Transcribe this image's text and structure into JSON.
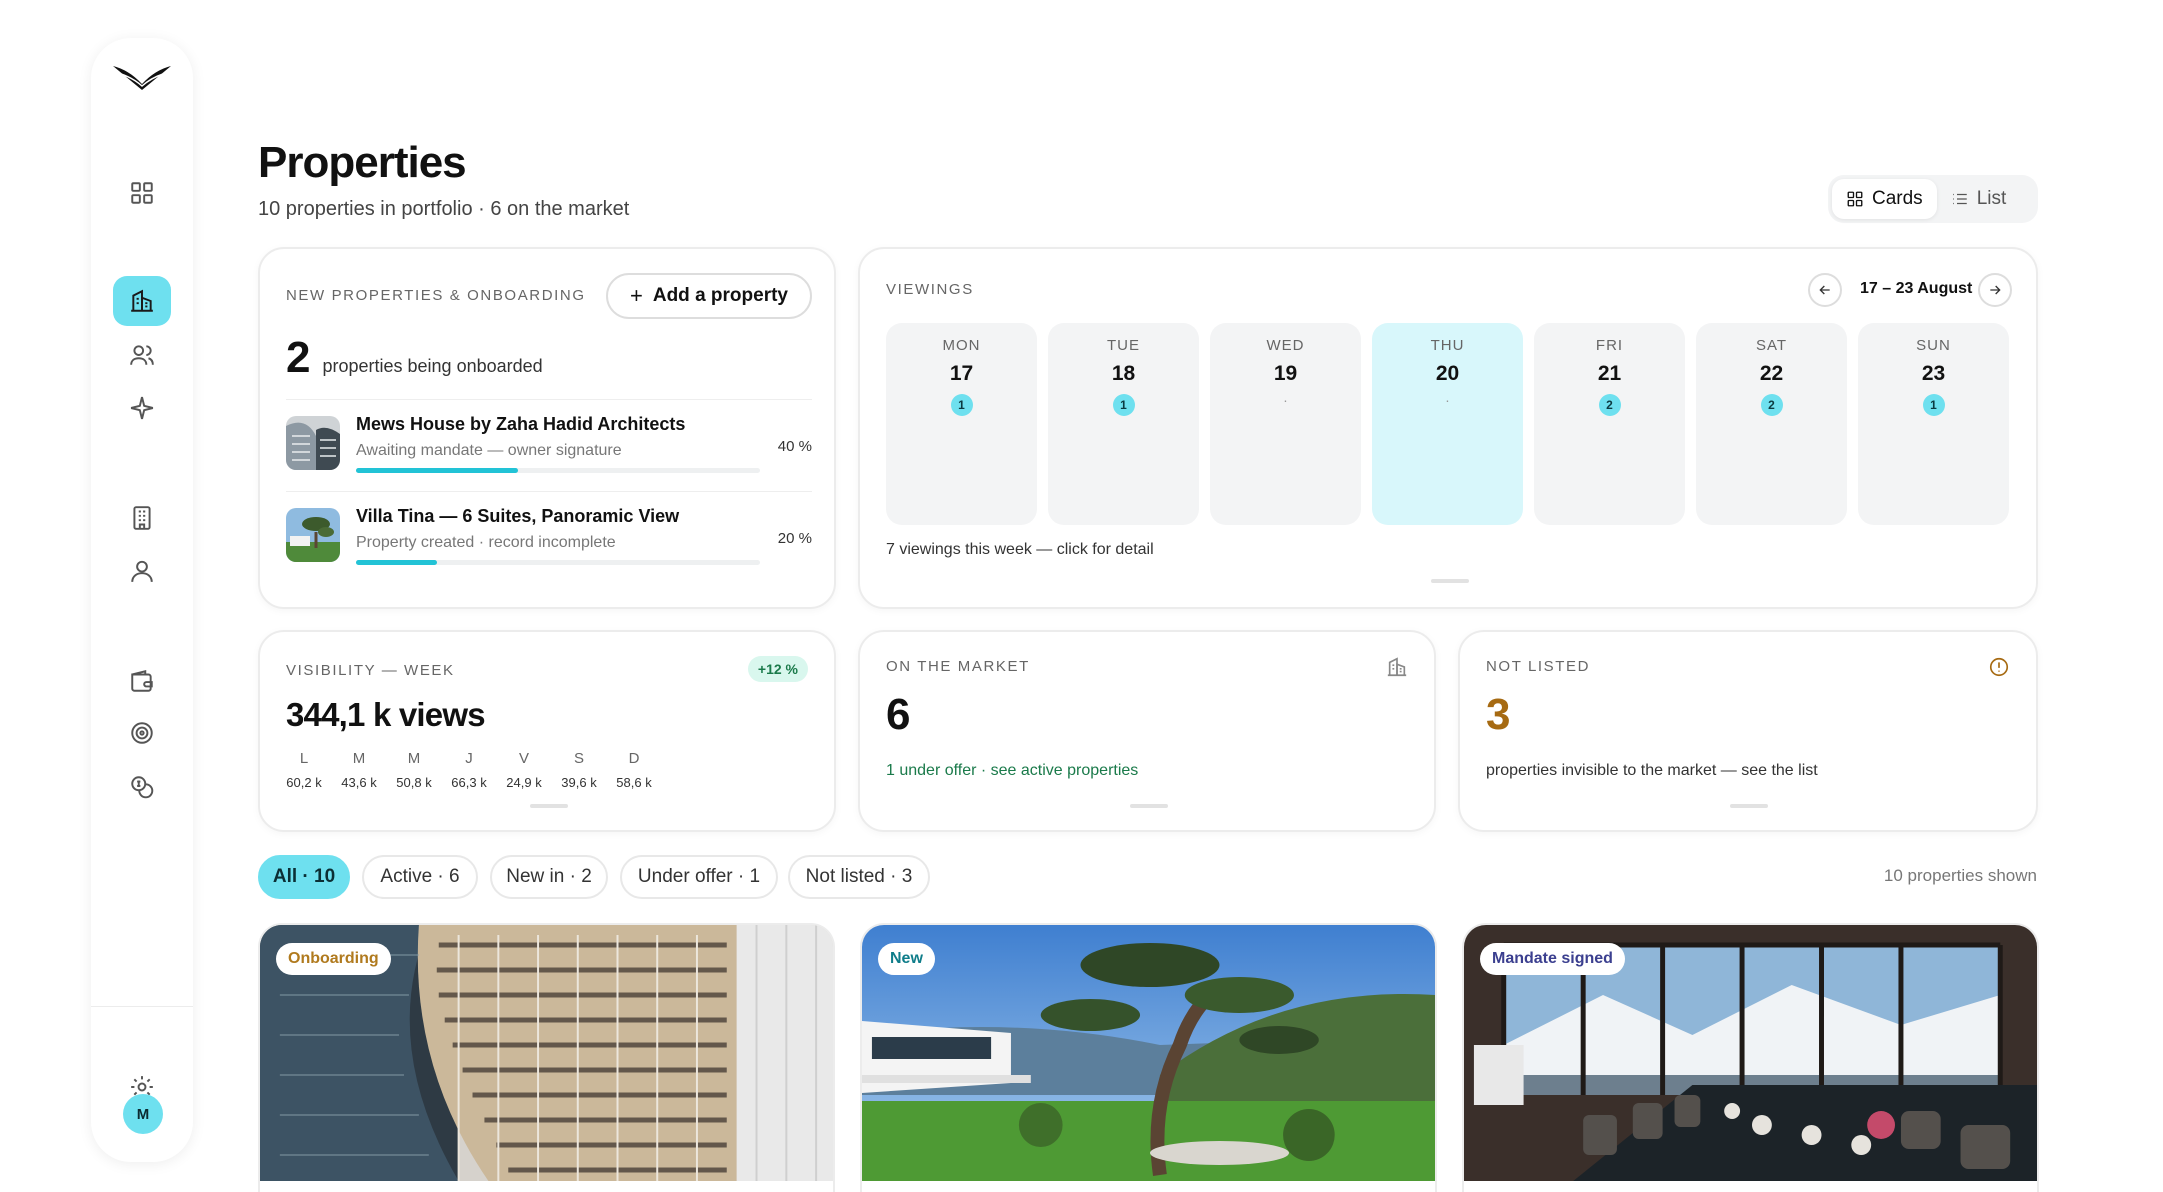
{
  "header": {
    "title": "Properties",
    "subtitle": "10 properties in portfolio · 6 on the market",
    "view_cards": "Cards",
    "view_list": "List"
  },
  "sidebar": {
    "items": [
      "dashboard",
      "properties",
      "contacts",
      "ai",
      "buildings",
      "owners",
      "wallet",
      "targets",
      "finance"
    ],
    "avatar_initial": "M"
  },
  "onboarding": {
    "label": "NEW PROPERTIES & ONBOARDING",
    "add_label": "Add a property",
    "count": "2",
    "count_text": "properties being onboarded",
    "items": [
      {
        "name": "Mews House by Zaha Hadid Architects",
        "status": "Awaiting mandate — owner signature",
        "percent_label": "40 %",
        "progress": 0.4
      },
      {
        "name": "Villa Tina — 6 Suites, Panoramic View",
        "status": "Property created · record incomplete",
        "percent_label": "20 %",
        "progress": 0.2
      }
    ]
  },
  "viewings": {
    "label": "VIEWINGS",
    "range": "17 – 23 August",
    "days": [
      {
        "name": "MON",
        "num": "17",
        "count": "1"
      },
      {
        "name": "TUE",
        "num": "18",
        "count": "1"
      },
      {
        "name": "WED",
        "num": "19",
        "count": ""
      },
      {
        "name": "THU",
        "num": "20",
        "count": ""
      },
      {
        "name": "FRI",
        "num": "21",
        "count": "2"
      },
      {
        "name": "SAT",
        "num": "22",
        "count": "2"
      },
      {
        "name": "SUN",
        "num": "23",
        "count": "1"
      }
    ],
    "empty_marker": "·",
    "footer": "7 viewings this week — click for detail"
  },
  "visibility": {
    "label": "VISIBILITY — WEEK",
    "delta": "+12 %",
    "views": "344,1 k views",
    "days": [
      {
        "d": "L",
        "v": "60,2 k"
      },
      {
        "d": "M",
        "v": "43,6 k"
      },
      {
        "d": "M",
        "v": "50,8 k"
      },
      {
        "d": "J",
        "v": "66,3 k"
      },
      {
        "d": "V",
        "v": "24,9 k"
      },
      {
        "d": "S",
        "v": "39,6 k"
      },
      {
        "d": "D",
        "v": "58,6 k"
      }
    ]
  },
  "on_market": {
    "label": "ON THE MARKET",
    "value": "6",
    "footer": "1 under offer · see active properties"
  },
  "not_listed": {
    "label": "NOT LISTED",
    "value": "3",
    "footer": "properties invisible to the market — see the list"
  },
  "filters": {
    "chips": [
      "All · 10",
      "Active · 6",
      "New in · 2",
      "Under offer · 1",
      "Not listed · 3"
    ],
    "shown": "10 properties shown"
  },
  "properties": [
    {
      "tag": "Onboarding",
      "tag_color": "#b07a1e"
    },
    {
      "tag": "New",
      "tag_color": "#0f7d8a"
    },
    {
      "tag": "Mandate signed",
      "tag_color": "#3b3f8f"
    }
  ],
  "colors": {
    "accent": "#6ee0ef",
    "progress": "#22c3d6",
    "positive": "#1a7a4a",
    "warning": "#a66a12"
  }
}
